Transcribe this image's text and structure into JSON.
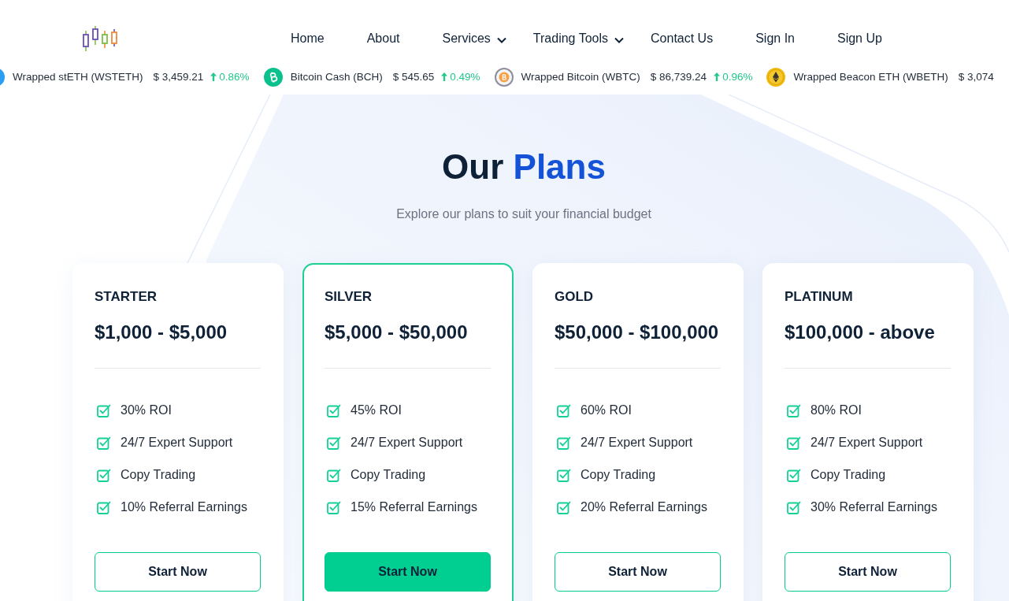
{
  "header": {
    "nav": [
      {
        "label": "Home",
        "dropdown": false
      },
      {
        "label": "About",
        "dropdown": false
      },
      {
        "label": "Services",
        "dropdown": true
      },
      {
        "label": "Trading Tools",
        "dropdown": true
      },
      {
        "label": "Contact Us",
        "dropdown": false
      },
      {
        "label": "Sign In",
        "dropdown": false
      },
      {
        "label": "Sign Up",
        "dropdown": false
      }
    ]
  },
  "ticker": [
    {
      "name": "Wrapped stETH (WSTETH)",
      "price": "$ 3,459.21",
      "change": "0.86%",
      "rising": true,
      "color": "#2a9df4"
    },
    {
      "name": "Bitcoin Cash (BCH)",
      "price": "$ 545.65",
      "change": "0.49%",
      "rising": true,
      "color": "#0ac18e"
    },
    {
      "name": "Wrapped Bitcoin (WBTC)",
      "price": "$ 86,739.24",
      "change": "0.96%",
      "rising": true,
      "color": "#8e8e9e"
    },
    {
      "name": "Wrapped Beacon ETH (WBETH)",
      "price": "$ 3,074",
      "color": "#f0b90b"
    }
  ],
  "plans_section": {
    "title": "Our",
    "title_highlight": "Plans",
    "subtitle": "Explore our plans to suit your financial budget",
    "plans": [
      {
        "name": "STARTER",
        "price": "$1,000 - $5,000",
        "features": [
          "30% ROI",
          "24/7 Expert Support",
          "Copy Trading",
          "10% Referral Earnings"
        ],
        "button": "Start Now",
        "featured": false
      },
      {
        "name": "SILVER",
        "price": "$5,000 - $50,000",
        "features": [
          "45% ROI",
          "24/7 Expert Support",
          "Copy Trading",
          "15% Referral Earnings"
        ],
        "button": "Start Now",
        "featured": true
      },
      {
        "name": "GOLD",
        "price": "$50,000 - $100,000",
        "features": [
          "60% ROI",
          "24/7 Expert Support",
          "Copy Trading",
          "20% Referral Earnings"
        ],
        "button": "Start Now",
        "featured": false
      },
      {
        "name": "PLATINUM",
        "price": "$100,000 - above",
        "features": [
          "80% ROI",
          "24/7 Expert Support",
          "Copy Trading",
          "30% Referral Earnings"
        ],
        "button": "Start Now",
        "featured": false
      }
    ]
  }
}
